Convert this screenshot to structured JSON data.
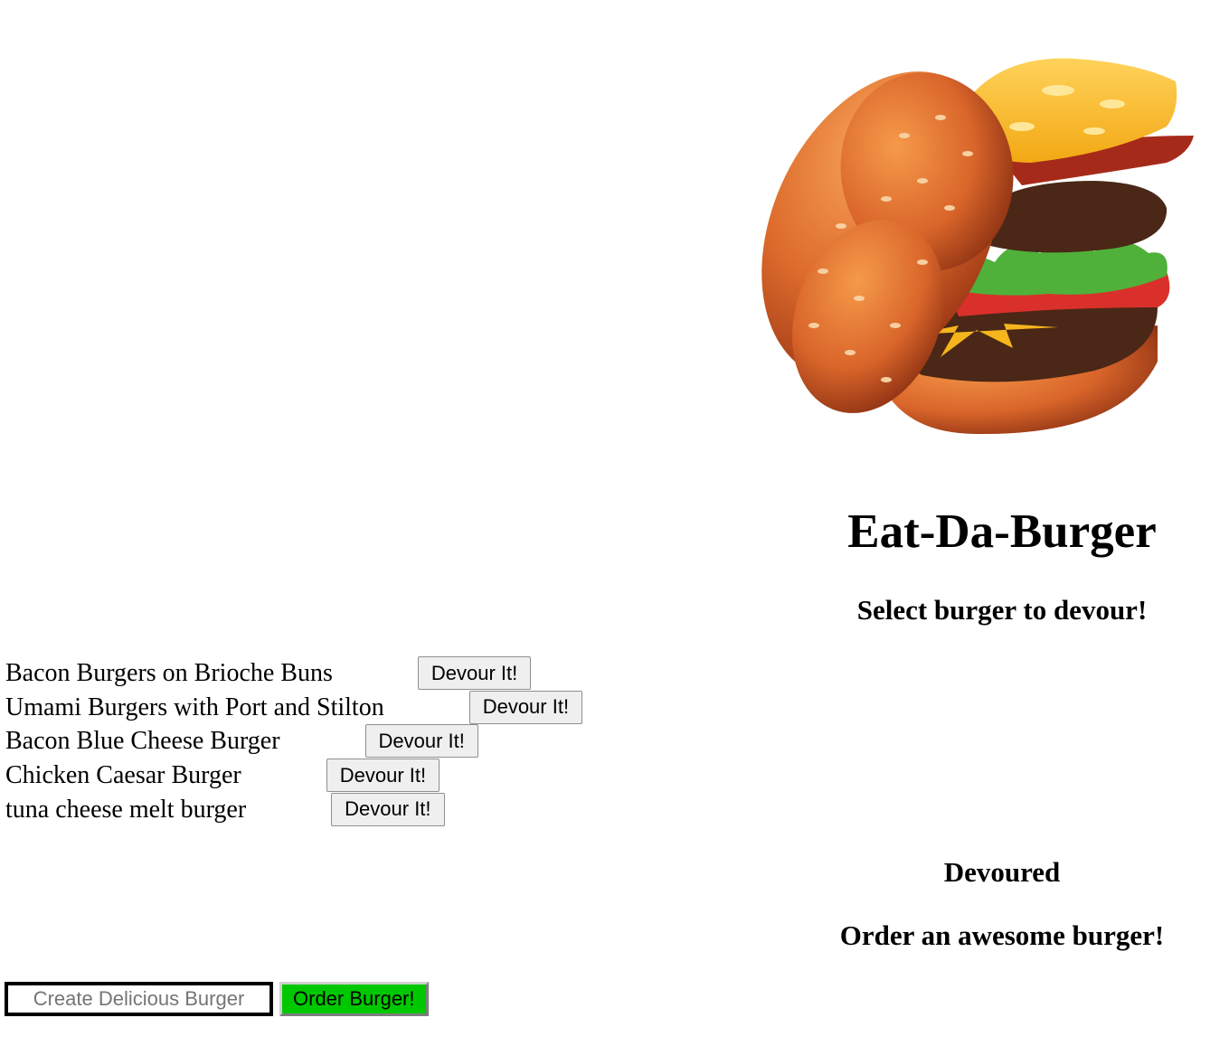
{
  "app": {
    "title": "Eat-Da-Burger",
    "select_heading": "Select burger to devour!",
    "devoured_heading": "Devoured",
    "order_heading": "Order an awesome burger!"
  },
  "hero_image": {
    "icon": "burger-illustration"
  },
  "burgers": [
    {
      "name": "Bacon Burgers on Brioche Buns",
      "button": "Devour It!"
    },
    {
      "name": "Umami Burgers with Port and Stilton",
      "button": "Devour It!"
    },
    {
      "name": "Bacon Blue Cheese Burger",
      "button": "Devour It!"
    },
    {
      "name": "Chicken Caesar Burger",
      "button": "Devour It!"
    },
    {
      "name": "tuna cheese melt burger",
      "button": "Devour It!"
    }
  ],
  "order_form": {
    "input_placeholder": "Create Delicious Burger",
    "input_value": "",
    "submit_label": "Order Burger!"
  },
  "colors": {
    "order_button": "#00c800",
    "bun": "#d9652a",
    "cheese": "#f6b51c",
    "lettuce": "#4fb13a",
    "tomato": "#d9302b",
    "patty": "#4a2716"
  }
}
